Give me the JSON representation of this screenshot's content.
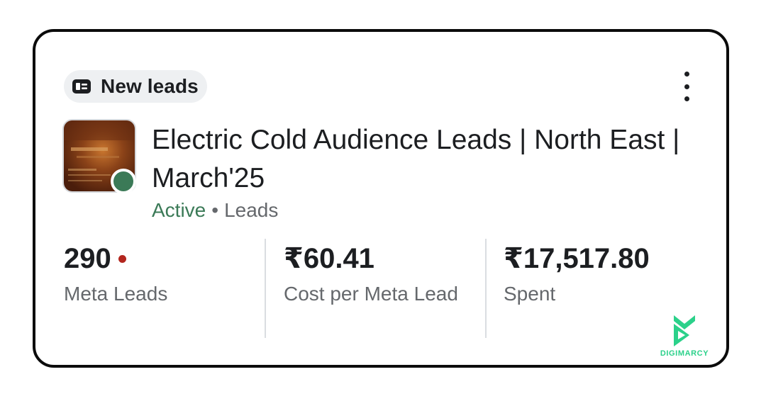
{
  "card": {
    "badge": {
      "label": "New leads",
      "icon": "lead-form-icon"
    },
    "menu": {
      "icon": "more-vertical-icon"
    },
    "thumbnail": {
      "icon": "ad-thumbnail-image",
      "status_color": "#3b7a57"
    },
    "title": "Electric Cold Audience Leads | North East | March'25",
    "status": "Active",
    "separator": "•",
    "objective": "Leads"
  },
  "metrics": [
    {
      "value": "290",
      "label": "Meta Leads",
      "indicator_color": "#b3261e"
    },
    {
      "value": "₹60.41",
      "label": "Cost per Meta Lead"
    },
    {
      "value": "₹17,517.80",
      "label": "Spent"
    }
  ],
  "watermark": {
    "text": "DIGIMARCY",
    "color": "#2bd18a"
  },
  "colors": {
    "active_green": "#3b7a57",
    "text_primary": "#1c1e21",
    "text_secondary": "#65686c",
    "alert_red": "#b3261e"
  }
}
